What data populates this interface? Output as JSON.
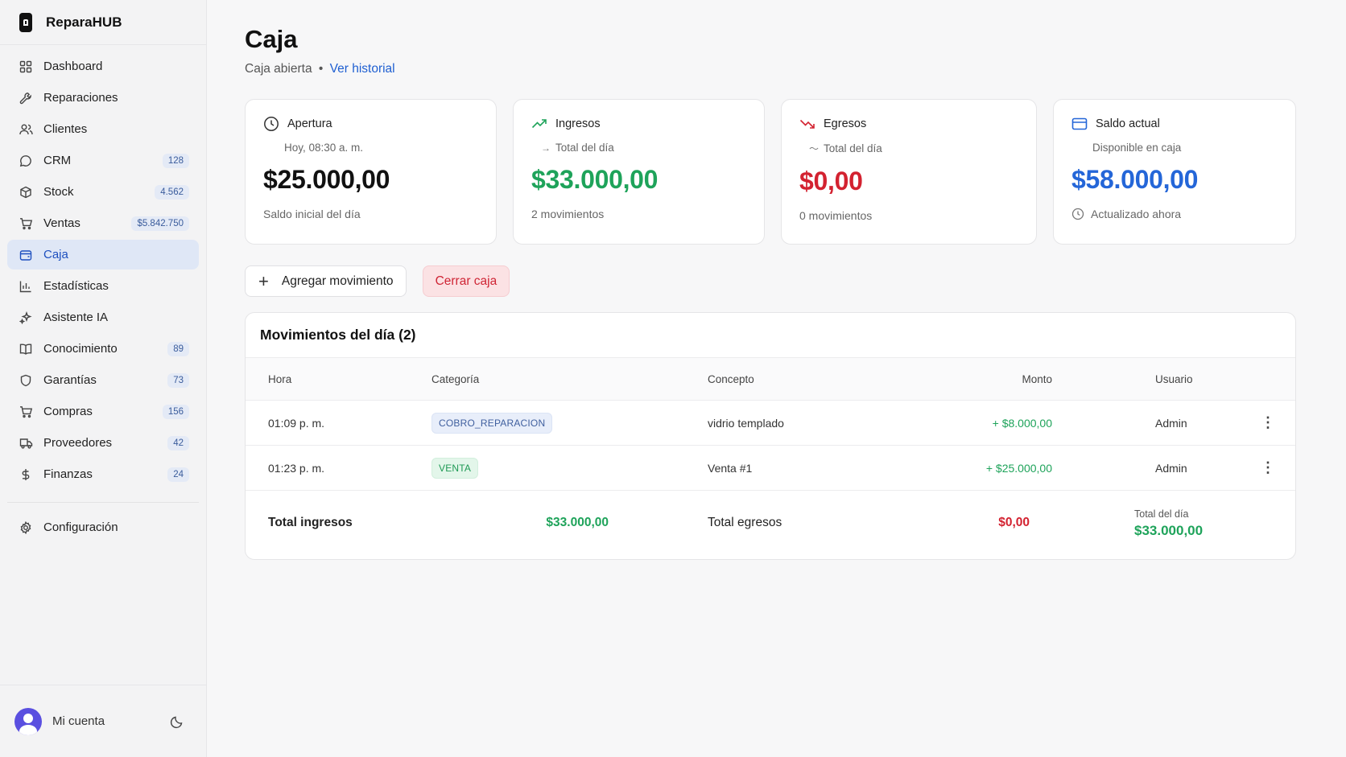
{
  "brand": {
    "name": "ReparaHUB"
  },
  "sidebar": {
    "items": [
      {
        "label": "Dashboard",
        "badge": null,
        "icon": "dashboard-icon"
      },
      {
        "label": "Reparaciones",
        "badge": null,
        "icon": "wrench-icon"
      },
      {
        "label": "Clientes",
        "badge": null,
        "icon": "users-icon"
      },
      {
        "label": "CRM",
        "badge": "128",
        "icon": "chat-icon"
      },
      {
        "label": "Stock",
        "badge": "4.562",
        "icon": "box-icon"
      },
      {
        "label": "Ventas",
        "badge": "$5.842.750",
        "icon": "cart-icon"
      },
      {
        "label": "Caja",
        "badge": null,
        "icon": "wallet-icon",
        "active": true
      },
      {
        "label": "Estadísticas",
        "badge": null,
        "icon": "bar-chart-icon"
      },
      {
        "label": "Asistente IA",
        "badge": null,
        "icon": "sparkles-icon"
      },
      {
        "label": "Conocimiento",
        "badge": "89",
        "icon": "book-icon"
      },
      {
        "label": "Garantías",
        "badge": "73",
        "icon": "shield-icon"
      },
      {
        "label": "Compras",
        "badge": "156",
        "icon": "cart-icon"
      },
      {
        "label": "Proveedores",
        "badge": "42",
        "icon": "truck-icon"
      },
      {
        "label": "Finanzas",
        "badge": "24",
        "icon": "dollar-icon"
      }
    ],
    "settings_label": "Configuración",
    "account_label": "Mi cuenta"
  },
  "header": {
    "title": "Caja",
    "status": "Caja abierta",
    "separator": "•",
    "history_link": "Ver historial"
  },
  "cards": {
    "apertura": {
      "title": "Apertura",
      "sub": "Hoy, 08:30 a. m.",
      "value": "$25.000,00",
      "foot": "Saldo inicial del día"
    },
    "ingresos": {
      "title": "Ingresos",
      "sub": "Total del día",
      "value": "$33.000,00",
      "foot": "2 movimientos"
    },
    "egresos": {
      "title": "Egresos",
      "sub": "Total del día",
      "value": "$0,00",
      "foot": "0 movimientos"
    },
    "saldo": {
      "title": "Saldo actual",
      "sub": "Disponible en caja",
      "value": "$58.000,00",
      "foot": "Actualizado ahora"
    }
  },
  "actions": {
    "add_label": "Agregar movimiento",
    "close_label": "Cerrar caja"
  },
  "movements": {
    "title": "Movimientos del día (2)",
    "columns": {
      "hora": "Hora",
      "categoria": "Categoría",
      "concepto": "Concepto",
      "monto": "Monto",
      "usuario": "Usuario"
    },
    "rows": [
      {
        "hora": "01:09 p. m.",
        "categoria": "COBRO_REPARACION",
        "concepto": "vidrio templado",
        "monto": "+ $8.000,00",
        "usuario": "Admin"
      },
      {
        "hora": "01:23 p. m.",
        "categoria": "VENTA",
        "concepto": "Venta #1",
        "monto": "+ $25.000,00",
        "usuario": "Admin"
      }
    ],
    "totals": {
      "ingresos_label": "Total ingresos",
      "ingresos_value": "$33.000,00",
      "egresos_label": "Total egresos",
      "egresos_value": "$0,00",
      "dia_label": "Total del día",
      "dia_value": "$33.000,00"
    }
  },
  "colors": {
    "accent": "#2466d8",
    "income": "#1ea35a",
    "expense": "#d32230",
    "active_bg": "#dfe7f6"
  }
}
